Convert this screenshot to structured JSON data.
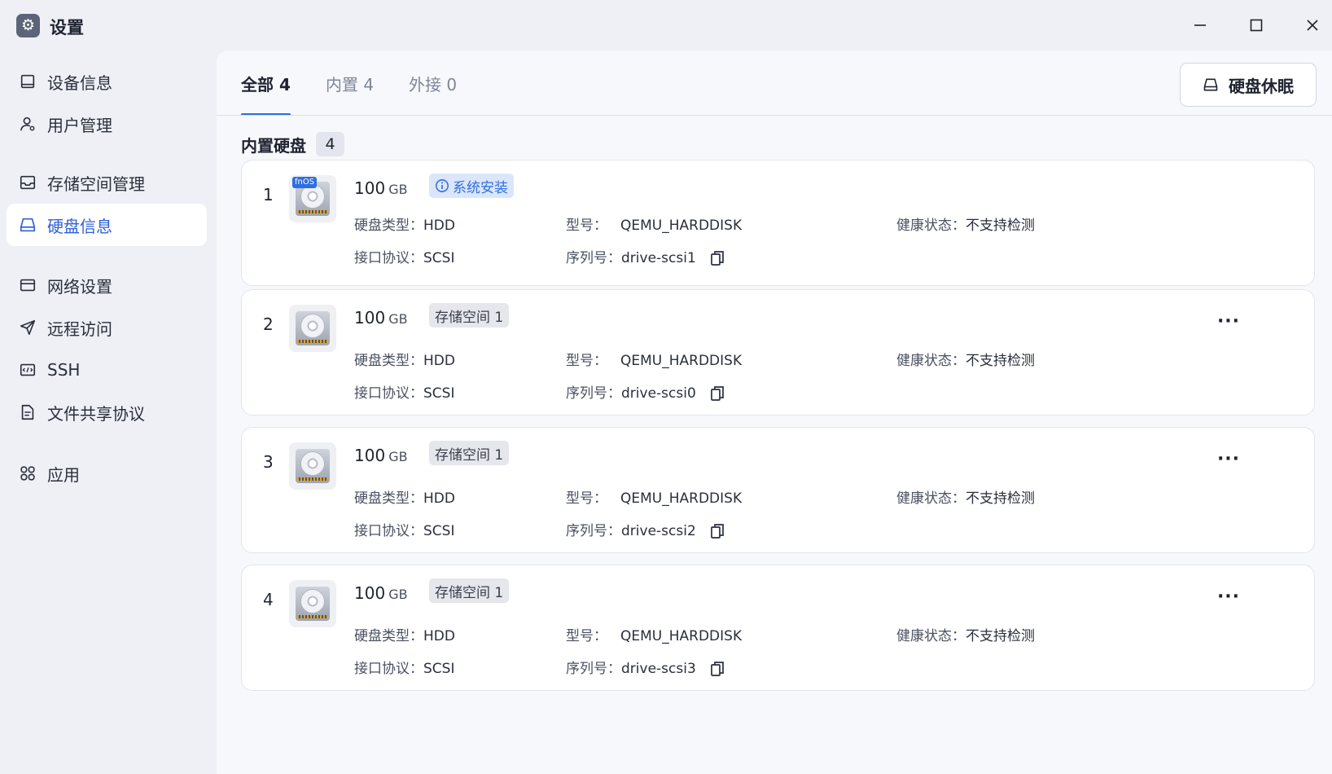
{
  "window": {
    "title": "设置",
    "app_icon": "gear-icon"
  },
  "sidebar": {
    "items": [
      {
        "label": "设备信息",
        "icon": "device-icon"
      },
      {
        "label": "用户管理",
        "icon": "user-icon"
      },
      {
        "label": "存储空间管理",
        "icon": "storage-icon"
      },
      {
        "label": "硬盘信息",
        "icon": "disk-icon",
        "active": true
      },
      {
        "label": "网络设置",
        "icon": "network-icon"
      },
      {
        "label": "远程访问",
        "icon": "send-icon"
      },
      {
        "label": "SSH",
        "icon": "terminal-icon"
      },
      {
        "label": "文件共享协议",
        "icon": "file-icon"
      },
      {
        "label": "应用",
        "icon": "apps-icon"
      }
    ]
  },
  "tabs": [
    {
      "label": "全部 4",
      "active": true
    },
    {
      "label": "内置 4"
    },
    {
      "label": "外接 0"
    }
  ],
  "sleep_button": "硬盘休眠",
  "section": {
    "title": "内置硬盘",
    "count": "4"
  },
  "labels": {
    "type": "硬盘类型：",
    "model": "型号：",
    "health": "健康状态：",
    "interface": "接口协议：",
    "serial": "序列号："
  },
  "disks": [
    {
      "index": "1",
      "capacity": "100",
      "unit": "GB",
      "tag": "系统安装",
      "tag_kind": "system",
      "os_badge": "fnOS",
      "type": "HDD",
      "model": "QEMU_HARDDISK",
      "health": "不支持检测",
      "interface": "SCSI",
      "serial": "drive-scsi1"
    },
    {
      "index": "2",
      "capacity": "100",
      "unit": "GB",
      "tag": "存储空间 1",
      "tag_kind": "pool",
      "type": "HDD",
      "model": "QEMU_HARDDISK",
      "health": "不支持检测",
      "interface": "SCSI",
      "serial": "drive-scsi0"
    },
    {
      "index": "3",
      "capacity": "100",
      "unit": "GB",
      "tag": "存储空间 1",
      "tag_kind": "pool",
      "type": "HDD",
      "model": "QEMU_HARDDISK",
      "health": "不支持检测",
      "interface": "SCSI",
      "serial": "drive-scsi2"
    },
    {
      "index": "4",
      "capacity": "100",
      "unit": "GB",
      "tag": "存储空间 1",
      "tag_kind": "pool",
      "type": "HDD",
      "model": "QEMU_HARDDISK",
      "health": "不支持检测",
      "interface": "SCSI",
      "serial": "drive-scsi3"
    }
  ],
  "colors": {
    "accent": "#2f6fe0",
    "sidebar_bg": "#eef0f6",
    "content_bg": "#f7f8fc"
  }
}
